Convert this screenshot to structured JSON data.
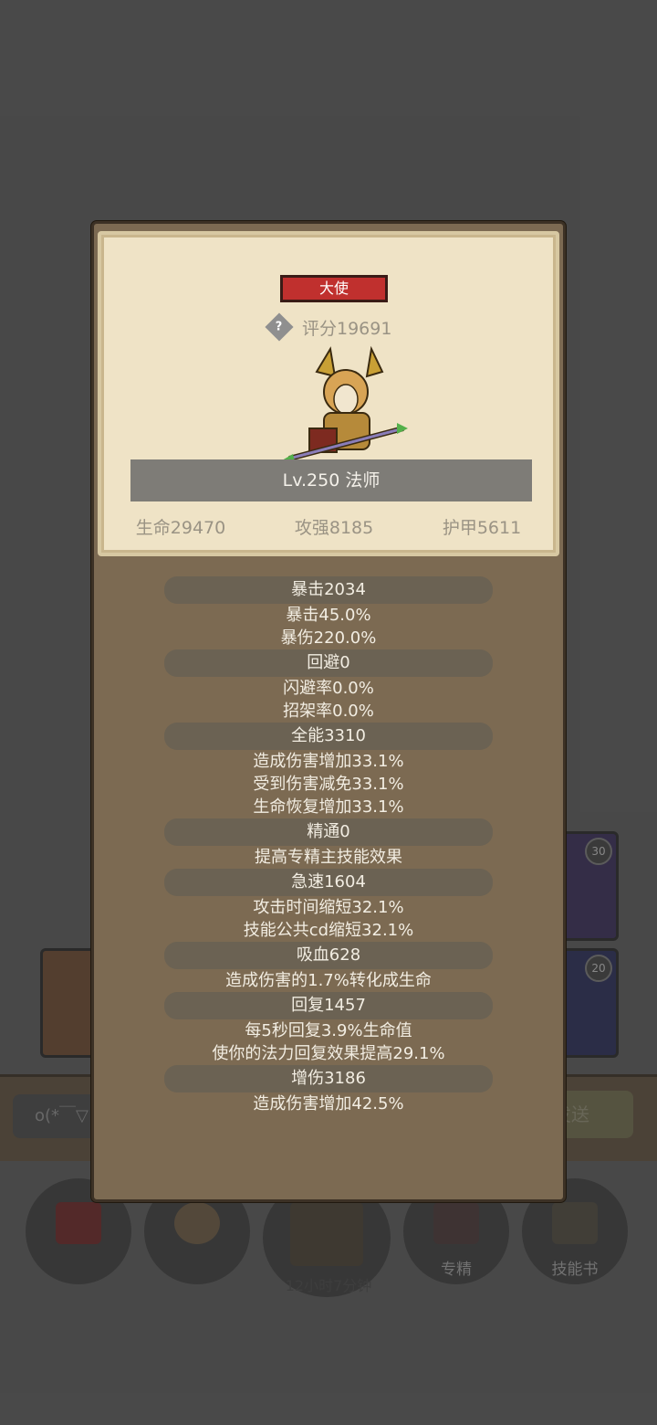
{
  "background": {
    "card_top_right_badge": "30",
    "card_mid_right_badge": "20",
    "chat_input_text": "o(*￣▽",
    "send_button": "发送",
    "buttons": [
      "专精",
      "技能书"
    ],
    "timer": "12小时7分钟"
  },
  "modal": {
    "rank": "大使",
    "score": "评分19691",
    "level": "Lv.250 法师",
    "stats": [
      "生命29470",
      "攻强8185",
      "护甲5611"
    ],
    "sections": [
      {
        "head": "暴击2034",
        "lines": [
          "暴击45.0%",
          "暴伤220.0%"
        ]
      },
      {
        "head": "回避0",
        "lines": [
          "闪避率0.0%",
          "招架率0.0%"
        ]
      },
      {
        "head": "全能3310",
        "lines": [
          "造成伤害增加33.1%",
          "受到伤害减免33.1%",
          "生命恢复增加33.1%"
        ]
      },
      {
        "head": "精通0",
        "lines": [
          "提高专精主技能效果"
        ]
      },
      {
        "head": "急速1604",
        "lines": [
          "攻击时间缩短32.1%",
          "技能公共cd缩短32.1%"
        ]
      },
      {
        "head": "吸血628",
        "lines": [
          "造成伤害的1.7%转化成生命"
        ]
      },
      {
        "head": "回复1457",
        "lines": [
          "每5秒回复3.9%生命值",
          "使你的法力回复效果提高29.1%"
        ]
      },
      {
        "head": "增伤3186",
        "lines": [
          "造成伤害增加42.5%"
        ]
      }
    ]
  },
  "colors": {
    "rank_tag": "#c0302e",
    "panel_brown": "#7c6a52",
    "parchment": "#efe3c6"
  }
}
